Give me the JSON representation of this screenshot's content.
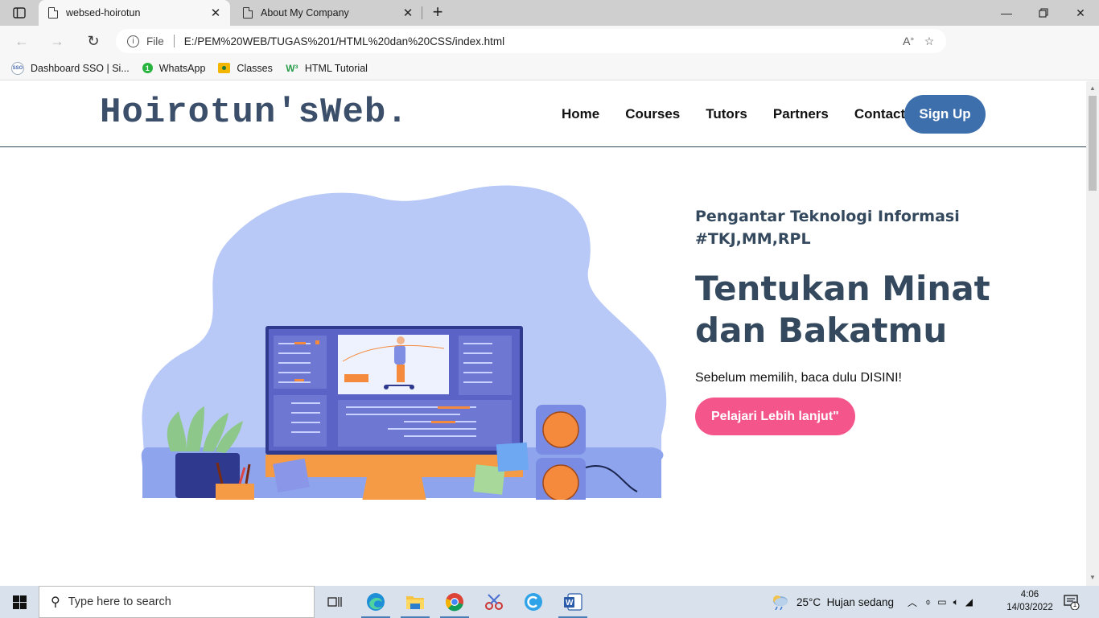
{
  "browser": {
    "tabs": [
      {
        "title": "websed-hoirotun",
        "active": true
      },
      {
        "title": "About My Company",
        "active": false
      }
    ],
    "address": {
      "scheme_label": "File",
      "url": "E:/PEM%20WEB/TUGAS%201/HTML%20dan%20CSS/index.html"
    },
    "bookmarks": [
      {
        "label": "Dashboard SSO | Si...",
        "icon": "sso-icon"
      },
      {
        "label": "WhatsApp",
        "icon": "whatsapp-icon"
      },
      {
        "label": "Classes",
        "icon": "classroom-icon"
      },
      {
        "label": "HTML Tutorial",
        "icon": "w3schools-icon"
      }
    ]
  },
  "site": {
    "logo": "Hoirotun'sWeb.",
    "nav": [
      "Home",
      "Courses",
      "Tutors",
      "Partners",
      "Contact"
    ],
    "signup": "Sign Up",
    "hero": {
      "subtitle_line1": "Pengantar Teknologi Informasi",
      "subtitle_line2": "#TKJ,MM,RPL",
      "headline_line1": "Tentukan Minat",
      "headline_line2": "dan Bakatmu",
      "description": "Sebelum memilih, baca dulu DISINI!",
      "cta": "Pelajari Lebih lanjut\""
    }
  },
  "taskbar": {
    "search_placeholder": "Type here to search",
    "weather": "25°C  Hujan sedang",
    "time": "4:06",
    "date": "14/03/2022",
    "notification_count": "1"
  },
  "colors": {
    "brand_text": "#3b4f6b",
    "signup_bg": "#3d6fad",
    "cta_bg": "#f4568c",
    "heading": "#34495e"
  }
}
